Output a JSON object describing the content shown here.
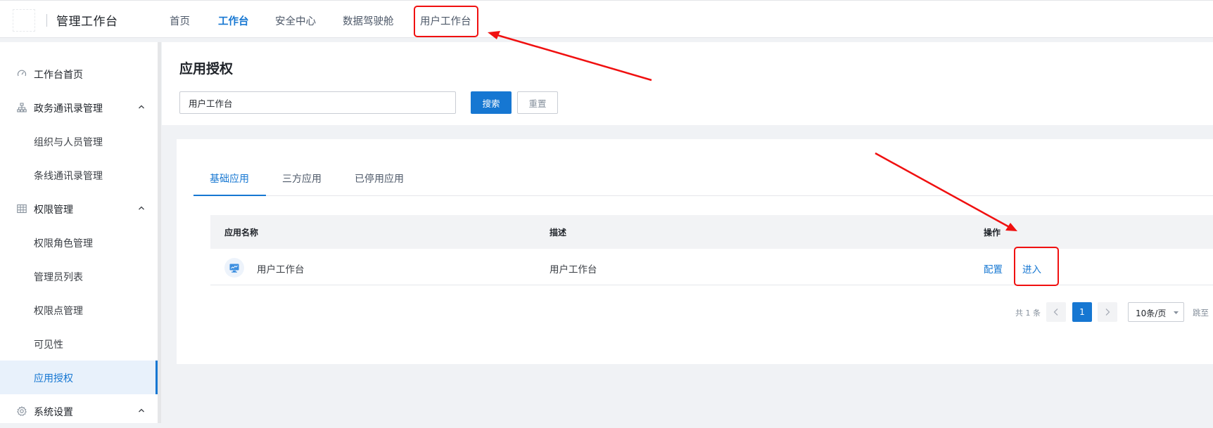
{
  "app": {
    "title": "管理工作台"
  },
  "topnav": {
    "items": [
      "首页",
      "工作台",
      "安全中心",
      "数据驾驶舱",
      "用户工作台"
    ],
    "active": "工作台"
  },
  "sidebar": {
    "items": [
      {
        "label": "工作台首页",
        "icon": "gauge-icon"
      },
      {
        "label": "政务通讯录管理",
        "icon": "org-tree-icon",
        "expanded": true
      },
      {
        "label": "组织与人员管理"
      },
      {
        "label": "条线通讯录管理"
      },
      {
        "label": "权限管理",
        "icon": "table-grid-icon",
        "expanded": true
      },
      {
        "label": "权限角色管理"
      },
      {
        "label": "管理员列表"
      },
      {
        "label": "权限点管理"
      },
      {
        "label": "可见性"
      },
      {
        "label": "应用授权",
        "selected": true
      },
      {
        "label": "系统设置",
        "icon": "gear-icon",
        "expanded": true
      }
    ]
  },
  "page": {
    "title": "应用授权",
    "search": {
      "value": "用户工作台"
    },
    "search_button": "搜索",
    "reset_button": "重置"
  },
  "tabs": [
    "基础应用",
    "三方应用",
    "已停用应用"
  ],
  "table": {
    "columns": [
      "应用名称",
      "描述",
      "操作"
    ],
    "rows": [
      {
        "name": "用户工作台",
        "description": "用户工作台",
        "actions": [
          "配置",
          "进入"
        ]
      }
    ]
  },
  "pagination": {
    "total": "共 1 条",
    "current_page": "1",
    "page_size": "10条/页",
    "jump": "跳至"
  },
  "colors": {
    "primary": "#1677d2",
    "annotation": "#f01010"
  }
}
